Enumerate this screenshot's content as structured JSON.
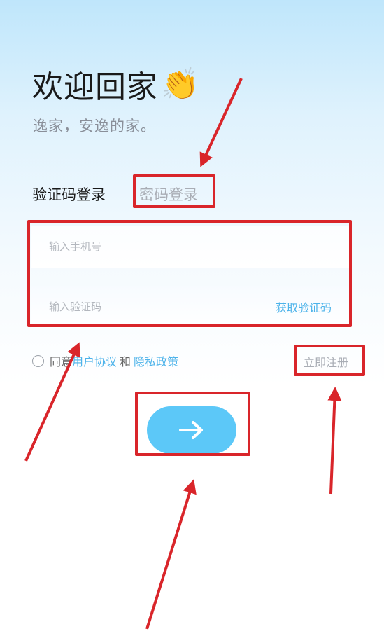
{
  "header": {
    "title": "欢迎回家",
    "emoji": "👏",
    "subtitle": "逸家，安逸的家。"
  },
  "tabs": [
    {
      "label": "验证码登录",
      "active": true
    },
    {
      "label": "密码登录",
      "active": false
    }
  ],
  "form": {
    "phone_placeholder": "输入手机号",
    "code_placeholder": "输入验证码",
    "get_code_label": "获取验证码"
  },
  "agreement": {
    "prefix": "同意",
    "user_agreement": "用户协议",
    "conjunction": "和",
    "privacy_policy": "隐私政策",
    "checked": false
  },
  "register_label": "立即注册",
  "colors": {
    "accent": "#4db3ea",
    "button": "#5cc8f8",
    "annotation": "#d9252a"
  }
}
